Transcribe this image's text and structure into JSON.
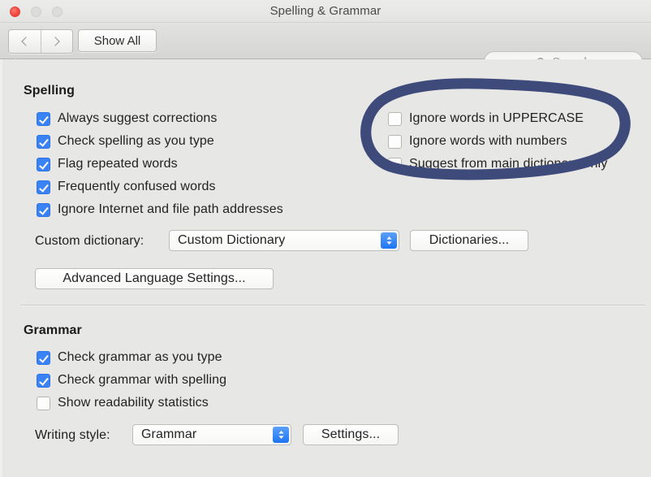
{
  "window": {
    "title": "Spelling & Grammar",
    "traffic_lights": [
      {
        "name": "close",
        "color": "#f2453c",
        "enabled": true
      },
      {
        "name": "minimize",
        "color": "#dcdcdc",
        "enabled": false
      },
      {
        "name": "zoom",
        "color": "#dcdcdc",
        "enabled": false
      }
    ]
  },
  "toolbar": {
    "back_label": "Back",
    "forward_label": "Forward",
    "show_all_label": "Show All",
    "search": {
      "icon": "search-icon",
      "placeholder": "Search",
      "value": ""
    }
  },
  "spelling": {
    "heading": "Spelling",
    "left_options": [
      {
        "label": "Always suggest corrections",
        "checked": true
      },
      {
        "label": "Check spelling as you type",
        "checked": true
      },
      {
        "label": "Flag repeated words",
        "checked": true
      },
      {
        "label": "Frequently confused words",
        "checked": true
      },
      {
        "label": "Ignore Internet and file path addresses",
        "checked": true
      }
    ],
    "right_options": [
      {
        "label": "Ignore words in UPPERCASE",
        "checked": false
      },
      {
        "label": "Ignore words with numbers",
        "checked": false
      },
      {
        "label": "Suggest from main dictionary only",
        "checked": false
      }
    ],
    "custom_dictionary": {
      "label": "Custom dictionary:",
      "value": "Custom Dictionary",
      "options": [
        "Custom Dictionary"
      ]
    },
    "dictionaries_button": "Dictionaries...",
    "advanced_button": "Advanced Language Settings..."
  },
  "grammar": {
    "heading": "Grammar",
    "options": [
      {
        "label": "Check grammar as you type",
        "checked": true
      },
      {
        "label": "Check grammar with spelling",
        "checked": true
      },
      {
        "label": "Show readability statistics",
        "checked": false
      }
    ],
    "writing_style": {
      "label": "Writing style:",
      "value": "Grammar",
      "options": [
        "Grammar"
      ]
    },
    "settings_button": "Settings..."
  },
  "annotation": {
    "shape": "hand-drawn-ellipse",
    "color": "#3e4a79",
    "targets": [
      "Ignore words in UPPERCASE",
      "Ignore words with numbers",
      "Suggest from main dictionary only"
    ]
  },
  "colors": {
    "checkbox_accent": "#3a82f7",
    "window_background": "#e7e7e6",
    "annotation_ink": "#3e4a79"
  }
}
